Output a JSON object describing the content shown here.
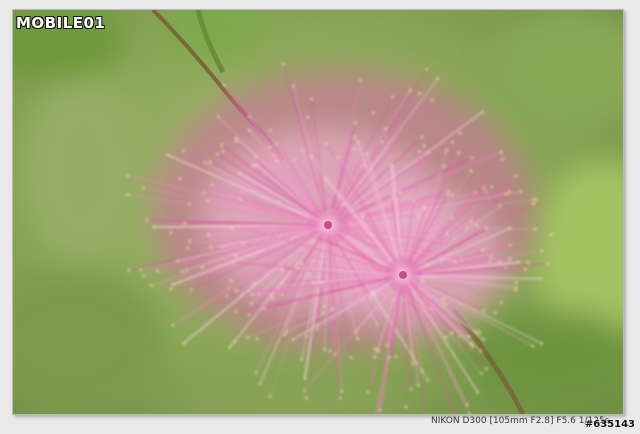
{
  "watermark": {
    "text": "MOBILE01"
  },
  "caption": {
    "exif": "NIKON D300 [105mm F2.8] F5.6 1/125s",
    "photo_id": "#635143"
  },
  "colors": {
    "background_green": "#8fa95a",
    "flower_pink": "#e06aa8",
    "stem_brown": "#7a5a3a"
  }
}
